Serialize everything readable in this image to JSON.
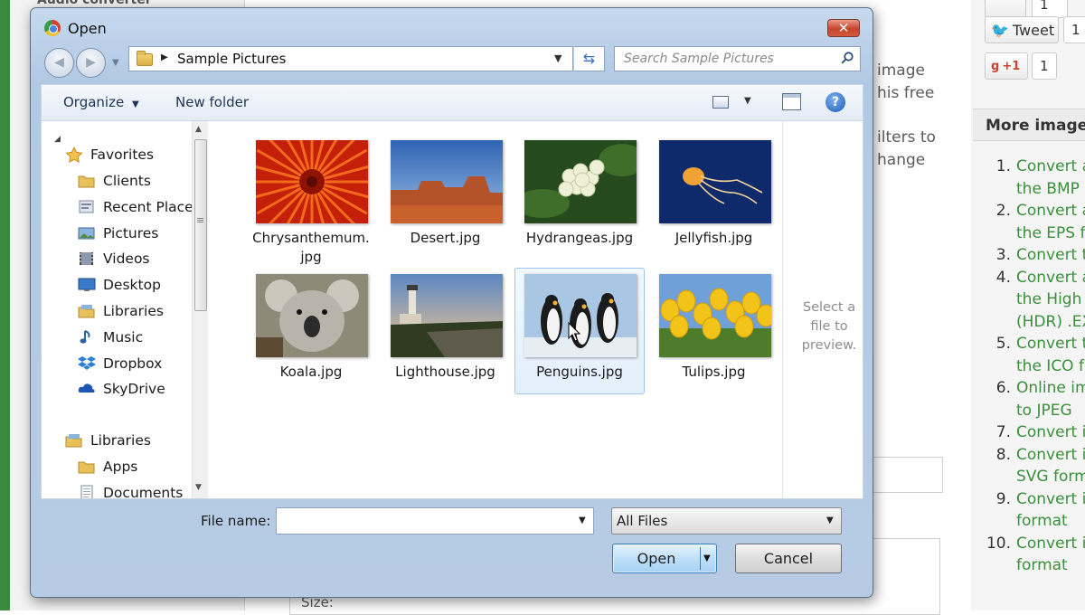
{
  "background_page": {
    "top_heading": "Audio converter",
    "body_lines": [
      "image",
      "his free",
      "ilters to",
      "hange"
    ],
    "size_label": "Size:",
    "share": {
      "tweet_label": "Tweet",
      "tweet_count": "1",
      "fb_count": "1",
      "gplus_label": "+1",
      "gplus_count": "1"
    },
    "more_images_header": "More image c",
    "more_items": [
      {
        "num": "1.",
        "lines": [
          "Convert a",
          "the BMP"
        ]
      },
      {
        "num": "2.",
        "lines": [
          "Convert a",
          "the EPS f"
        ]
      },
      {
        "num": "3.",
        "lines": [
          "Convert t"
        ]
      },
      {
        "num": "4.",
        "lines": [
          "Convert a",
          "the High",
          "(HDR) .EX"
        ]
      },
      {
        "num": "5.",
        "lines": [
          "Convert t",
          "the ICO f"
        ]
      },
      {
        "num": "6.",
        "lines": [
          "Online im",
          "to JPEG"
        ]
      },
      {
        "num": "7.",
        "lines": [
          "Convert i"
        ]
      },
      {
        "num": "8.",
        "lines": [
          "Convert i",
          "SVG form"
        ]
      },
      {
        "num": "9.",
        "lines": [
          "Convert i",
          "format"
        ]
      },
      {
        "num": "10.",
        "lines": [
          "Convert i",
          "format"
        ]
      }
    ],
    "colors": {
      "link": "#3a8f3a",
      "strip": "#3c8a3c"
    }
  },
  "dialog": {
    "title": "Open",
    "close_symbol": "✕",
    "address": {
      "current_folder": "Sample Pictures"
    },
    "search": {
      "placeholder": "Search Sample Pictures"
    },
    "toolbar": {
      "organize": "Organize",
      "new_folder": "New folder",
      "help": "?"
    },
    "nav": {
      "favorites_header": "Favorites",
      "favorites": [
        {
          "label": "Clients",
          "icon": "folder-icon"
        },
        {
          "label": "Recent Places",
          "icon": "recent-places-icon"
        },
        {
          "label": "Pictures",
          "icon": "pictures-icon"
        },
        {
          "label": "Videos",
          "icon": "videos-icon"
        },
        {
          "label": "Desktop",
          "icon": "desktop-icon"
        },
        {
          "label": "Libraries",
          "icon": "libraries-icon"
        },
        {
          "label": "Music",
          "icon": "music-icon"
        },
        {
          "label": "Dropbox",
          "icon": "dropbox-icon"
        },
        {
          "label": "SkyDrive",
          "icon": "skydrive-icon"
        }
      ],
      "libraries_header": "Libraries",
      "libraries": [
        {
          "label": "Apps",
          "icon": "folder-icon"
        },
        {
          "label": "Documents",
          "icon": "documents-icon"
        }
      ]
    },
    "files": [
      {
        "name": "Chrysanthemum.jpg",
        "label_lines": [
          "Chrysanthemum.",
          "jpg"
        ],
        "selected": false
      },
      {
        "name": "Desert.jpg",
        "label_lines": [
          "Desert.jpg"
        ],
        "selected": false
      },
      {
        "name": "Hydrangeas.jpg",
        "label_lines": [
          "Hydrangeas.jpg"
        ],
        "selected": false
      },
      {
        "name": "Jellyfish.jpg",
        "label_lines": [
          "Jellyfish.jpg"
        ],
        "selected": false
      },
      {
        "name": "Koala.jpg",
        "label_lines": [
          "Koala.jpg"
        ],
        "selected": false
      },
      {
        "name": "Lighthouse.jpg",
        "label_lines": [
          "Lighthouse.jpg"
        ],
        "selected": false
      },
      {
        "name": "Penguins.jpg",
        "label_lines": [
          "Penguins.jpg"
        ],
        "selected": true
      },
      {
        "name": "Tulips.jpg",
        "label_lines": [
          "Tulips.jpg"
        ],
        "selected": false
      }
    ],
    "preview_text": "Select a file to preview.",
    "file_name": {
      "label": "File name:",
      "value": ""
    },
    "filter": {
      "selected": "All Files"
    },
    "buttons": {
      "open": "Open",
      "cancel": "Cancel"
    },
    "colors": {
      "selection": "#9dc5ee",
      "title_close": "#c7442c"
    }
  }
}
